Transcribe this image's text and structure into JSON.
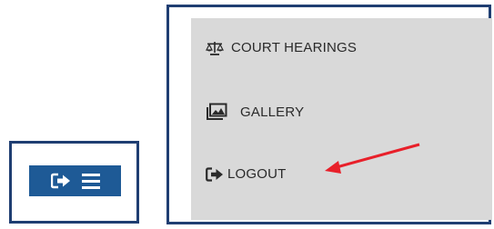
{
  "toolbar": {
    "icons": [
      "logout-icon",
      "hamburger-menu-icon"
    ],
    "background_color": "#1e5a96"
  },
  "menu": {
    "items": [
      {
        "label": "COURT HEARINGS",
        "icon": "scales-of-justice-icon"
      },
      {
        "label": "GALLERY",
        "icon": "image-gallery-icon"
      },
      {
        "label": "LOGOUT",
        "icon": "logout-icon"
      }
    ],
    "background_color": "#d9d9d9"
  },
  "annotation": {
    "arrow_color": "#e8202a",
    "points_to": "LOGOUT"
  },
  "frame_color": "#1f3e72"
}
